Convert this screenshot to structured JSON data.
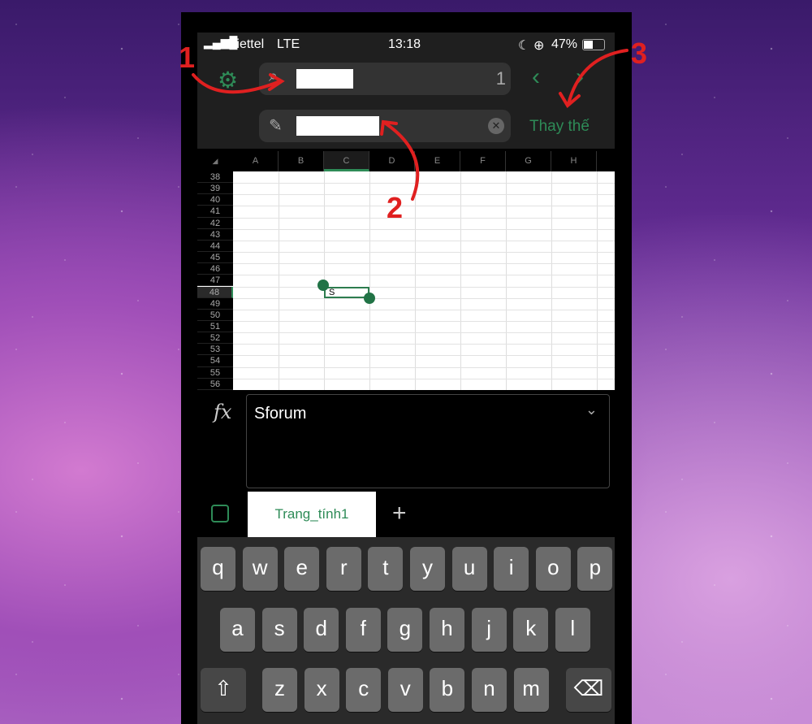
{
  "status": {
    "carrier": "Viettel",
    "network": "LTE",
    "time": "13:18",
    "battery": "47%"
  },
  "find": {
    "count": "1",
    "replace_label": "Thay thế"
  },
  "columns": [
    "A",
    "B",
    "C",
    "D",
    "E",
    "F",
    "G",
    "H"
  ],
  "rows": [
    "38",
    "39",
    "40",
    "41",
    "42",
    "43",
    "44",
    "45",
    "46",
    "47",
    "48",
    "49",
    "50",
    "51",
    "52",
    "53",
    "54",
    "55",
    "56"
  ],
  "selected": {
    "column": "C",
    "row": "48",
    "cell_text": "S"
  },
  "formula": {
    "fx": "fx",
    "value": "Sforum"
  },
  "sheet_tab": "Trang_tính1",
  "add_sheet": "+",
  "keyboard": {
    "row1": [
      "q",
      "w",
      "e",
      "r",
      "t",
      "y",
      "u",
      "i",
      "o",
      "p"
    ],
    "row2": [
      "a",
      "s",
      "d",
      "f",
      "g",
      "h",
      "j",
      "k",
      "l"
    ],
    "row3": [
      "z",
      "x",
      "c",
      "v",
      "b",
      "n",
      "m"
    ]
  },
  "annotations": [
    "1",
    "2",
    "3"
  ],
  "colors": {
    "accent": "#2e8b57",
    "annotation": "#e02020"
  }
}
